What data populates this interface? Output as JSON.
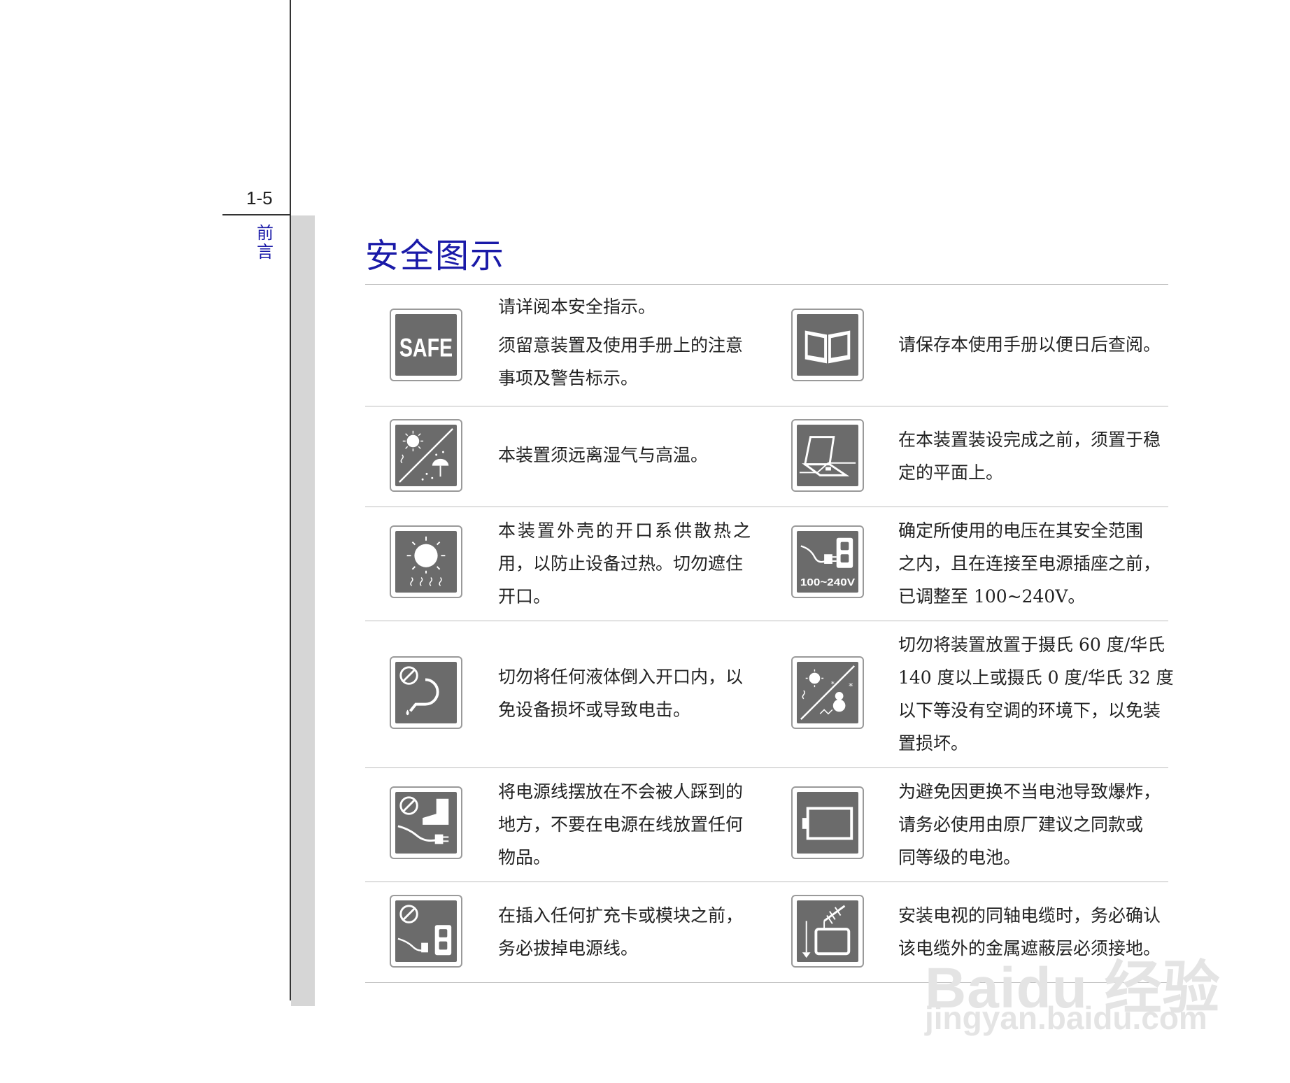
{
  "header": {
    "page_number": "1-5",
    "section": "前言"
  },
  "title": "安全图示",
  "rows": [
    {
      "left": {
        "icon": "safe-icon",
        "icon_text": "SAFE",
        "lines": [
          "请详阅本安全指示。",
          "须留意装置及使用手册上的注意",
          "事项及警告标示。"
        ]
      },
      "right": {
        "icon": "manual-book-icon",
        "lines": [
          "请保存本使用手册以便日后查阅。"
        ]
      }
    },
    {
      "left": {
        "icon": "heat-humidity-icon",
        "lines": [
          "本装置须远离湿气与高温。"
        ]
      },
      "right": {
        "icon": "laptop-flat-surface-icon",
        "lines": [
          "在本装置装设完成之前，须置于稳",
          "定的平面上。"
        ]
      }
    },
    {
      "left": {
        "icon": "ventilation-heat-icon",
        "lines": [
          "本装置外壳的开口系供散热之",
          "用，以防止设备过热。切勿遮住",
          "开口。"
        ]
      },
      "right": {
        "icon": "voltage-outlet-icon",
        "icon_text": "100~240V",
        "lines": [
          "确定所使用的电压在其安全范围",
          "之内，且在连接至电源插座之前，",
          "已调整至 100~240V。"
        ]
      }
    },
    {
      "left": {
        "icon": "no-liquid-icon",
        "lines": [
          "切勿将任何液体倒入开口内，以",
          "免设备损坏或导致电击。"
        ]
      },
      "right": {
        "icon": "temperature-range-icon",
        "lines": [
          "切勿将装置放置于摄氏 60 度/华氏",
          "140 度以上或摄氏 0 度/华氏 32 度",
          "以下等没有空调的环境下，以免装",
          "置损坏。"
        ]
      }
    },
    {
      "left": {
        "icon": "no-step-cord-icon",
        "lines": [
          "将电源线摆放在不会被人踩到的",
          "地方，不要在电源在线放置任何",
          "物品。"
        ]
      },
      "right": {
        "icon": "battery-icon",
        "lines": [
          "为避免因更换不当电池导致爆炸，",
          "请务必使用由原厂建议之同款或",
          "同等级的电池。"
        ]
      }
    },
    {
      "left": {
        "icon": "unplug-before-install-icon",
        "lines": [
          "在插入任何扩充卡或模块之前，",
          "务必拔掉电源线。"
        ]
      },
      "right": {
        "icon": "tv-antenna-ground-icon",
        "lines": [
          "安装电视的同轴电缆时，务必确认",
          "该电缆外的金属遮蔽层必须接地。"
        ]
      }
    }
  ],
  "watermark": {
    "logo": "Baidu 经验",
    "url": "jingyan.baidu.com"
  }
}
